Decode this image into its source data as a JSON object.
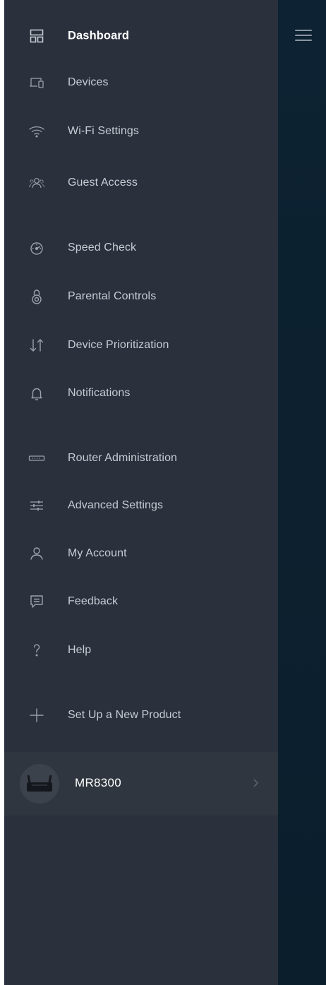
{
  "nav": {
    "items": [
      {
        "label": "Dashboard",
        "icon": "dashboard-icon",
        "active": true
      },
      {
        "label": "Devices",
        "icon": "devices-icon"
      },
      {
        "label": "Wi-Fi Settings",
        "icon": "wifi-icon"
      },
      {
        "label": "Guest Access",
        "icon": "guest-icon"
      },
      {
        "label": "Speed Check",
        "icon": "speedometer-icon"
      },
      {
        "label": "Parental Controls",
        "icon": "lock-icon"
      },
      {
        "label": "Device Prioritization",
        "icon": "priority-arrows-icon"
      },
      {
        "label": "Notifications",
        "icon": "bell-icon"
      },
      {
        "label": "Router Administration",
        "icon": "router-icon"
      },
      {
        "label": "Advanced Settings",
        "icon": "sliders-icon"
      },
      {
        "label": "My Account",
        "icon": "user-icon"
      },
      {
        "label": "Feedback",
        "icon": "chat-icon"
      },
      {
        "label": "Help",
        "icon": "question-icon"
      },
      {
        "label": "Set Up a New Product",
        "icon": "plus-icon"
      }
    ]
  },
  "router": {
    "name": "MR8300"
  },
  "colors": {
    "sidebar_bg": "#2a303c",
    "right_panel_bg": "#0d2232",
    "text": "#c7ccd3",
    "active_text": "#ffffff"
  }
}
